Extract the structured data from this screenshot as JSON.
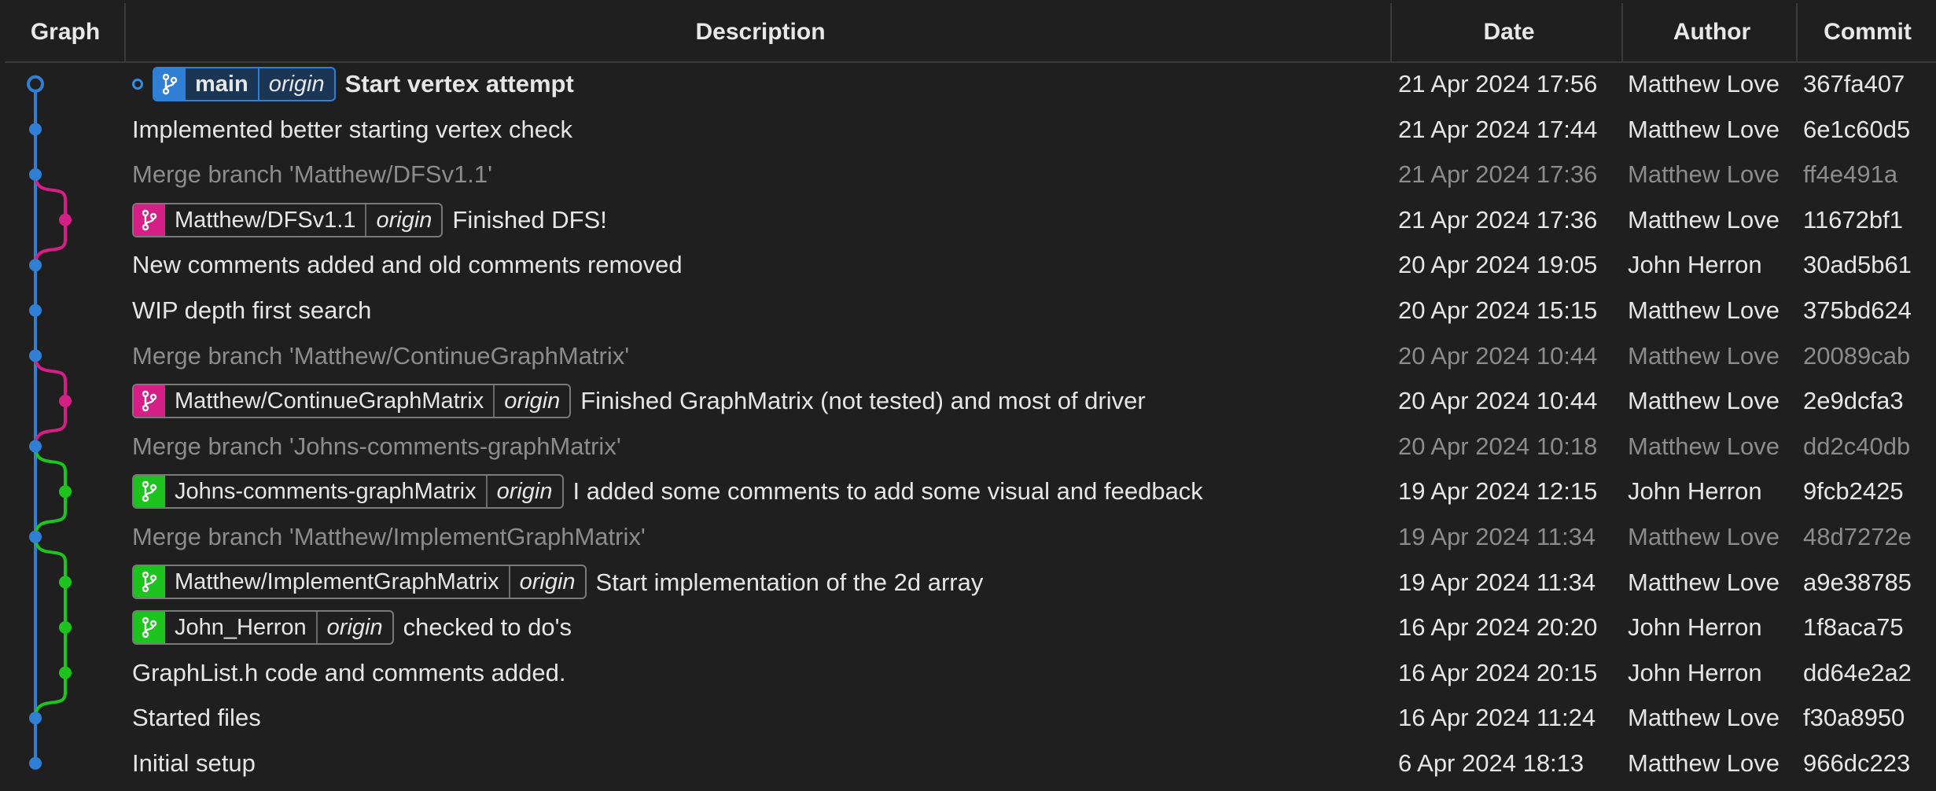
{
  "header": {
    "graph": "Graph",
    "description": "Description",
    "date": "Date",
    "author": "Author",
    "commit": "Commit"
  },
  "colors": {
    "main": "#2f7fd4",
    "pink": "#d61f86",
    "green": "#1ec41e"
  },
  "icons": {
    "branch": "git-branch-icon",
    "head": "head-marker-icon"
  },
  "commits": [
    {
      "refs": [
        {
          "name": "main",
          "remote": "origin",
          "color": "main"
        }
      ],
      "message": "Start vertex attempt",
      "date": "21 Apr 2024 17:56",
      "author": "Matthew Love",
      "hash": "367fa407",
      "merge": false,
      "head": true
    },
    {
      "refs": [],
      "message": "Implemented better starting vertex check",
      "date": "21 Apr 2024 17:44",
      "author": "Matthew Love",
      "hash": "6e1c60d5",
      "merge": false
    },
    {
      "refs": [],
      "message": "Merge branch 'Matthew/DFSv1.1'",
      "date": "21 Apr 2024 17:36",
      "author": "Matthew Love",
      "hash": "ff4e491a",
      "merge": true
    },
    {
      "refs": [
        {
          "name": "Matthew/DFSv1.1",
          "remote": "origin",
          "color": "pink"
        }
      ],
      "message": "Finished DFS!",
      "date": "21 Apr 2024 17:36",
      "author": "Matthew Love",
      "hash": "11672bf1",
      "merge": false
    },
    {
      "refs": [],
      "message": "New comments added and old comments removed",
      "date": "20 Apr 2024 19:05",
      "author": "John Herron",
      "hash": "30ad5b61",
      "merge": false
    },
    {
      "refs": [],
      "message": "WIP depth first search",
      "date": "20 Apr 2024 15:15",
      "author": "Matthew Love",
      "hash": "375bd624",
      "merge": false
    },
    {
      "refs": [],
      "message": "Merge branch 'Matthew/ContinueGraphMatrix'",
      "date": "20 Apr 2024 10:44",
      "author": "Matthew Love",
      "hash": "20089cab",
      "merge": true
    },
    {
      "refs": [
        {
          "name": "Matthew/ContinueGraphMatrix",
          "remote": "origin",
          "color": "pink"
        }
      ],
      "message": "Finished GraphMatrix (not tested) and most of driver",
      "date": "20 Apr 2024 10:44",
      "author": "Matthew Love",
      "hash": "2e9dcfa3",
      "merge": false
    },
    {
      "refs": [],
      "message": "Merge branch 'Johns-comments-graphMatrix'",
      "date": "20 Apr 2024 10:18",
      "author": "Matthew Love",
      "hash": "dd2c40db",
      "merge": true
    },
    {
      "refs": [
        {
          "name": "Johns-comments-graphMatrix",
          "remote": "origin",
          "color": "green"
        }
      ],
      "message": "I added some comments to add some visual and feedback",
      "date": "19 Apr 2024 12:15",
      "author": "John Herron",
      "hash": "9fcb2425",
      "merge": false
    },
    {
      "refs": [],
      "message": "Merge branch 'Matthew/ImplementGraphMatrix'",
      "date": "19 Apr 2024 11:34",
      "author": "Matthew Love",
      "hash": "48d7272e",
      "merge": true
    },
    {
      "refs": [
        {
          "name": "Matthew/ImplementGraphMatrix",
          "remote": "origin",
          "color": "green"
        }
      ],
      "message": "Start implementation of the 2d array",
      "date": "19 Apr 2024 11:34",
      "author": "Matthew Love",
      "hash": "a9e38785",
      "merge": false
    },
    {
      "refs": [
        {
          "name": "John_Herron",
          "remote": "origin",
          "color": "green"
        }
      ],
      "message": "checked to do's",
      "date": "16 Apr 2024 20:20",
      "author": "John Herron",
      "hash": "1f8aca75",
      "merge": false
    },
    {
      "refs": [],
      "message": "GraphList.h code and comments added.",
      "date": "16 Apr 2024 20:15",
      "author": "John Herron",
      "hash": "dd64e2a2",
      "merge": false
    },
    {
      "refs": [],
      "message": "Started files",
      "date": "16 Apr 2024 11:24",
      "author": "Matthew Love",
      "hash": "f30a8950",
      "merge": false
    },
    {
      "refs": [],
      "message": "Initial setup",
      "date": "6 Apr 2024 18:13",
      "author": "Matthew Love",
      "hash": "966dc223",
      "merge": false
    }
  ]
}
